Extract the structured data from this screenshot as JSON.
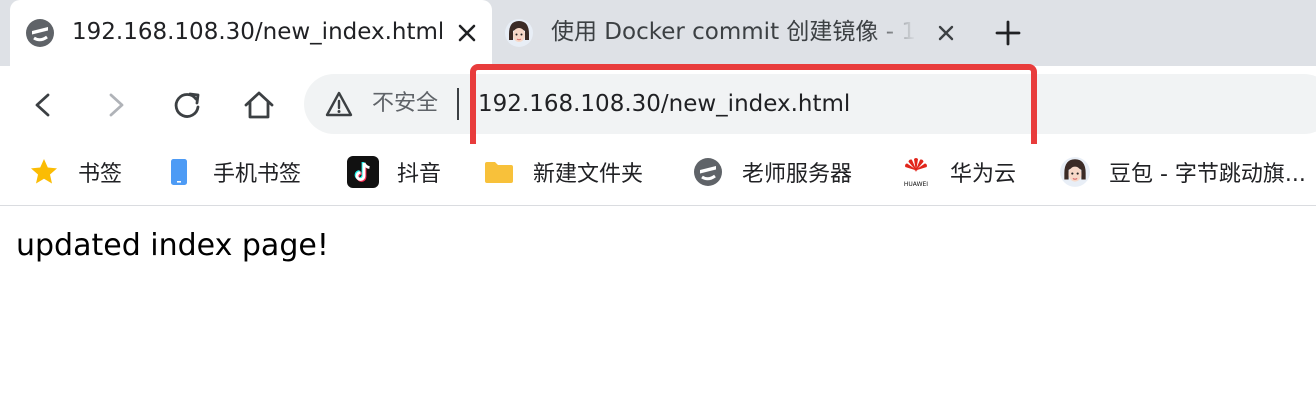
{
  "tabs": [
    {
      "title": "192.168.108.30/new_index.html",
      "favicon": "e-logo-icon",
      "active": true
    },
    {
      "title": "使用 Docker commit 创建镜像 - 1",
      "favicon": "avatar-icon",
      "active": false
    }
  ],
  "toolbar": {
    "security_label": "不安全",
    "url": "192.168.108.30/new_index.html"
  },
  "bookmarks": [
    {
      "label": "书签",
      "icon": "star-icon"
    },
    {
      "label": "手机书签",
      "icon": "phone-icon"
    },
    {
      "label": "抖音",
      "icon": "tiktok-icon"
    },
    {
      "label": "新建文件夹",
      "icon": "folder-icon"
    },
    {
      "label": "老师服务器",
      "icon": "e-logo-icon"
    },
    {
      "label": "华为云",
      "icon": "huawei-icon"
    },
    {
      "label": "豆包 - 字节跳动旗...",
      "icon": "avatar-icon"
    }
  ],
  "huawei_logo_text": "HUAWEI",
  "page": {
    "body_text": "updated index page!"
  },
  "colors": {
    "highlight_border": "#e83c3c",
    "tabstrip_bg": "#dee1e6",
    "omnibox_bg": "#f1f3f4",
    "star": "#fbbc04",
    "folder": "#f8c13a",
    "phone": "#4d9bf5"
  }
}
